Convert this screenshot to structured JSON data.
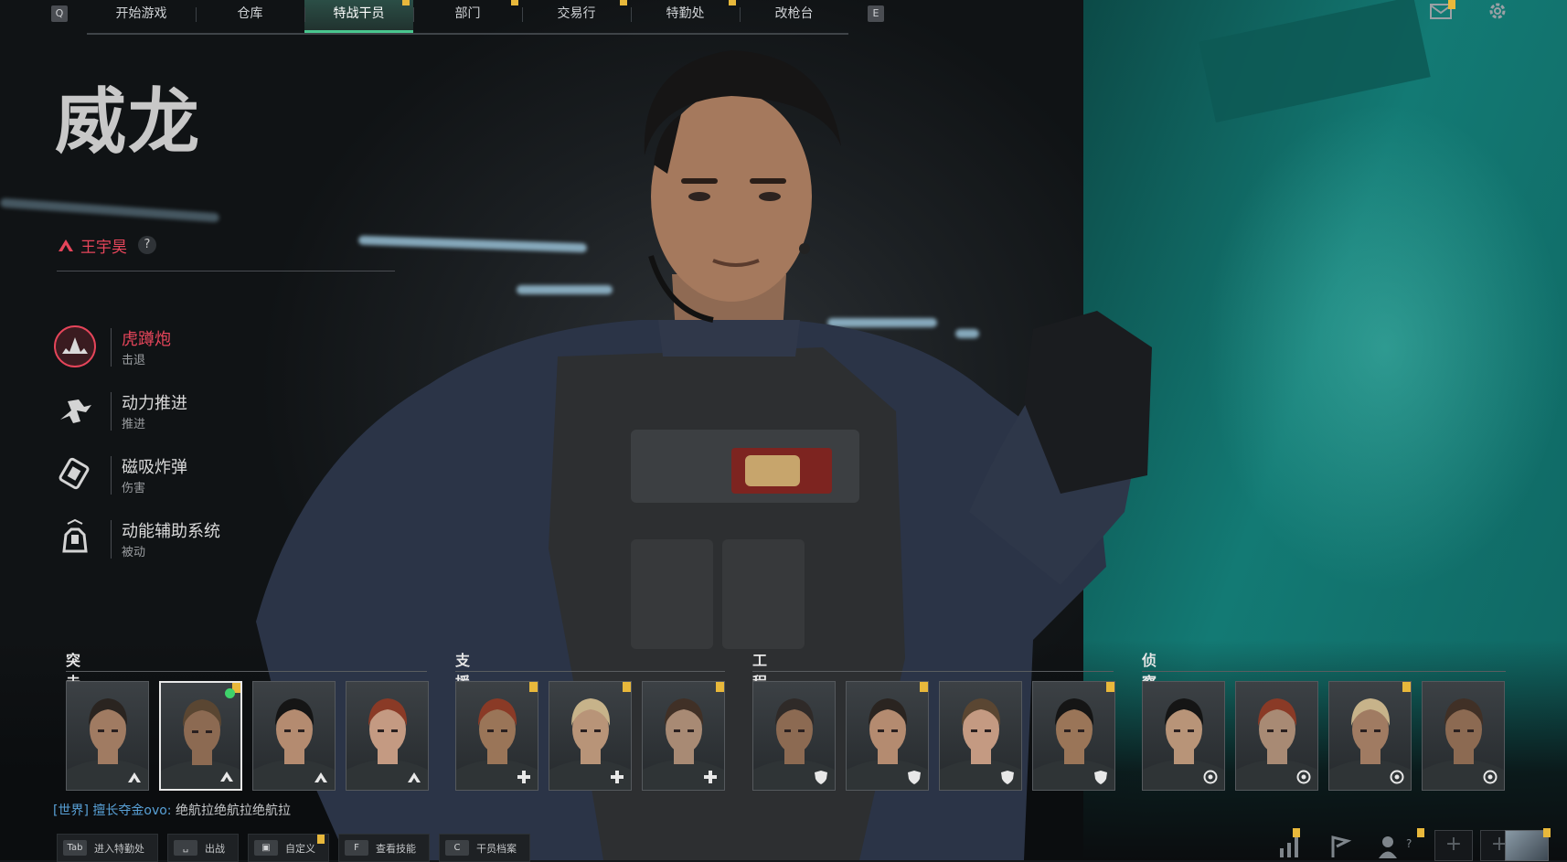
{
  "keys": {
    "left": "Q",
    "right": "E"
  },
  "tabs": [
    {
      "label": "开始游戏",
      "active": false,
      "note": false
    },
    {
      "label": "仓库",
      "active": false,
      "note": false
    },
    {
      "label": "特战干员",
      "active": true,
      "note": true
    },
    {
      "label": "部门",
      "active": false,
      "note": true
    },
    {
      "label": "交易行",
      "active": false,
      "note": true
    },
    {
      "label": "特勤处",
      "active": false,
      "note": true
    },
    {
      "label": "改枪台",
      "active": false,
      "note": false
    }
  ],
  "operator": {
    "name": "威龙",
    "real_name": "王宇昊",
    "help": "?",
    "abilities": [
      {
        "title": "虎蹲炮",
        "type": "击退",
        "icon": "tiger-cannon-icon",
        "active": true
      },
      {
        "title": "动力推进",
        "type": "推进",
        "icon": "power-dash-icon",
        "active": false
      },
      {
        "title": "磁吸炸弹",
        "type": "伤害",
        "icon": "magnetic-bomb-icon",
        "active": false
      },
      {
        "title": "动能辅助系统",
        "type": "被动",
        "icon": "kinetic-system-icon",
        "active": false
      }
    ]
  },
  "roster": {
    "groups": [
      {
        "label": "突击",
        "badge": "assault-chevron-icon",
        "count": 4,
        "new_flags": [
          false,
          true,
          false,
          false
        ],
        "selected_index": 1,
        "online_index": 1
      },
      {
        "label": "支援",
        "badge": "support-plus-icon",
        "count": 3,
        "new_flags": [
          true,
          true,
          true
        ]
      },
      {
        "label": "工程",
        "badge": "engineer-shield-icon",
        "count": 4,
        "new_flags": [
          false,
          true,
          false,
          true
        ]
      },
      {
        "label": "侦察",
        "badge": "recon-target-icon",
        "count": 4,
        "new_flags": [
          false,
          false,
          true,
          false
        ]
      }
    ]
  },
  "chat": {
    "channel": "[世界]",
    "sender": "擅长夺金ovo:",
    "message": "绝航拉绝航拉绝航拉"
  },
  "hints": [
    {
      "key": "Tab",
      "label": "进入特勤处",
      "new": false
    },
    {
      "key": "␣",
      "label": "出战",
      "new": false
    },
    {
      "key": "▣",
      "label": "自定义",
      "new": true
    },
    {
      "key": "F",
      "label": "查看技能",
      "new": false
    },
    {
      "key": "C",
      "label": "干员档案",
      "new": false
    }
  ],
  "bottom_right": {
    "friends_count": "?",
    "plus": "+"
  },
  "colors": {
    "accent_green": "#49c68e",
    "highlight_red": "#e6455a",
    "notice_yellow": "#e8b83b",
    "teal_wall": "#137a74"
  }
}
